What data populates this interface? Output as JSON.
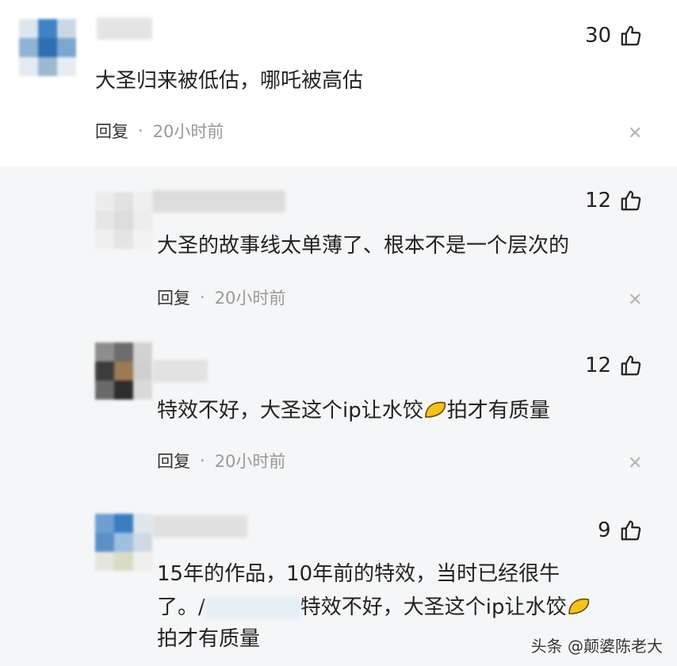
{
  "comments": [
    {
      "text": "大圣归来被低估，哪吒被高估",
      "likes": "30",
      "reply_label": "回复",
      "time": "20小时前"
    },
    {
      "text": "大圣的故事线太单薄了、根本不是一个层次的",
      "likes": "12",
      "reply_label": "回复",
      "time": "20小时前"
    },
    {
      "text_before": "特效不好，大圣这个ip让水饺",
      "text_after": "拍才有质量",
      "likes": "12",
      "reply_label": "回复",
      "time": "20小时前"
    },
    {
      "line1": "15年的作品，10年前的特效，当时已经很牛",
      "line2_prefix": "了。/",
      "line2_rest": "特效不好，大圣这个ip让水饺",
      "line3": "拍才有质量",
      "likes": "9"
    }
  ],
  "dot": "·",
  "close_glyph": "✕",
  "watermark": "头条 @颠婆陈老大",
  "icons": {
    "like": "thumbs-up-icon",
    "close": "close-icon",
    "emoji": "dumpling-emoji-icon"
  }
}
